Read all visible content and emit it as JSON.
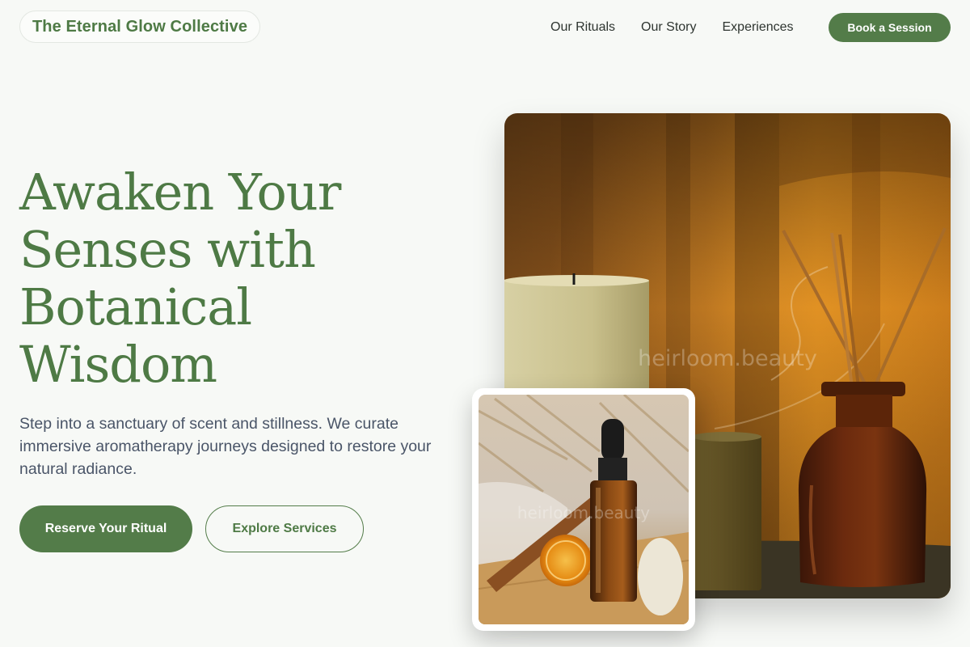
{
  "brand": {
    "name": "The Eternal Glow Collective"
  },
  "nav": {
    "links": [
      "Our Rituals",
      "Our Story",
      "Experiences"
    ],
    "cta": "Book a Session"
  },
  "hero": {
    "title_lines": [
      "Awaken Your",
      "Senses with",
      "Botanical",
      "Wisdom"
    ],
    "subtitle": "Step into a sanctuary of scent and stillness. We curate immersive aromatherapy journeys designed to restore your natural radiance.",
    "primary_cta": "Reserve Your Ritual",
    "secondary_cta": "Explore Services"
  },
  "images": {
    "main_watermark": "heirloom.beauty",
    "card_watermark": "heirloom.beauty"
  },
  "colors": {
    "accent": "#537c49",
    "title": "#4e7a45",
    "background": "#f7f9f6",
    "body_text": "#4a5568"
  }
}
